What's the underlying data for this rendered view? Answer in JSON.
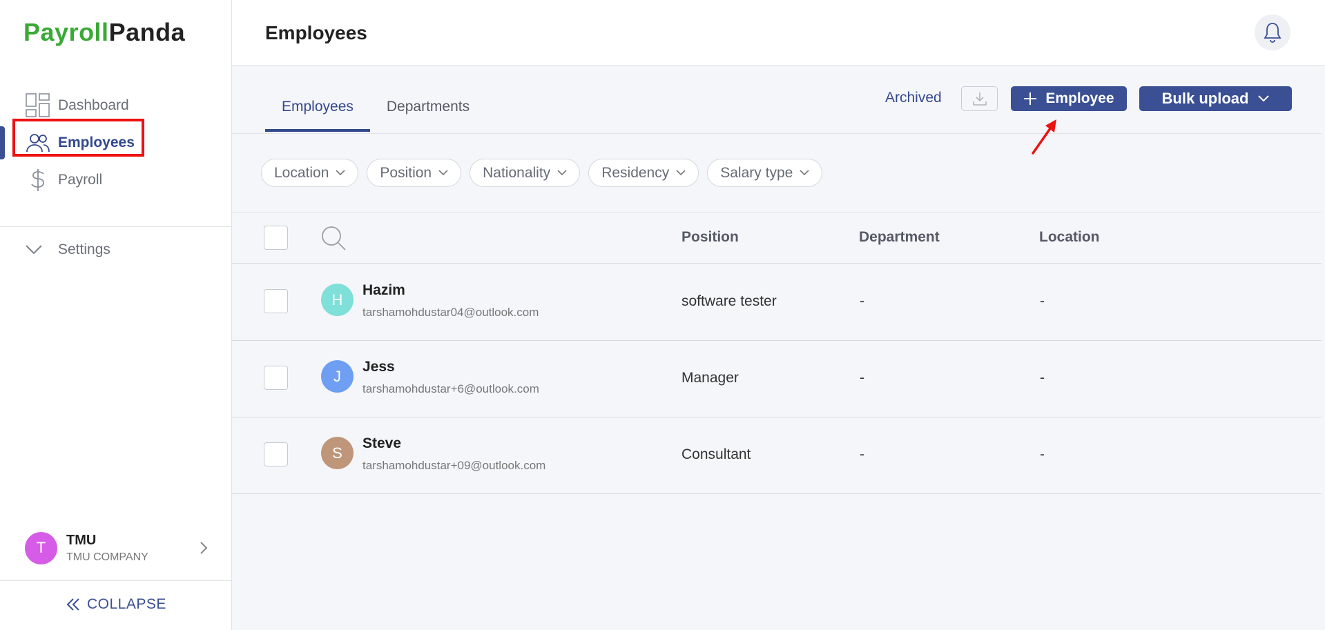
{
  "brand": {
    "part1": "Payroll",
    "part2": "Panda"
  },
  "sidebar": {
    "items": [
      {
        "label": "Dashboard",
        "icon": "dashboard-icon"
      },
      {
        "label": "Employees",
        "icon": "users-icon"
      },
      {
        "label": "Payroll",
        "icon": "dollar-icon"
      }
    ],
    "settings_label": "Settings",
    "company": {
      "initial": "T",
      "name": "TMU",
      "subtitle": "TMU COMPANY"
    },
    "collapse_label": "COLLAPSE"
  },
  "header": {
    "title": "Employees"
  },
  "tabs": [
    {
      "label": "Employees"
    },
    {
      "label": "Departments"
    }
  ],
  "actions": {
    "archived": "Archived",
    "add_employee": "Employee",
    "bulk_upload": "Bulk upload"
  },
  "filters": [
    {
      "label": "Location"
    },
    {
      "label": "Position"
    },
    {
      "label": "Nationality"
    },
    {
      "label": "Residency"
    },
    {
      "label": "Salary type"
    }
  ],
  "table": {
    "columns": [
      "Position",
      "Department",
      "Location"
    ],
    "rows": [
      {
        "initial": "H",
        "name": "Hazim",
        "email": "tarshamohdustar04@outlook.com",
        "position": "software tester",
        "department": "-",
        "location": "-",
        "avatar_color": "#7fdfd9"
      },
      {
        "initial": "J",
        "name": "Jess",
        "email": "tarshamohdustar+6@outlook.com",
        "position": "Manager",
        "department": "-",
        "location": "-",
        "avatar_color": "#6e9ff2"
      },
      {
        "initial": "S",
        "name": "Steve",
        "email": "tarshamohdustar+09@outlook.com",
        "position": "Consultant",
        "department": "-",
        "location": "-",
        "avatar_color": "#bf9679"
      }
    ]
  },
  "colors": {
    "brand_green": "#3aa935",
    "primary": "#3a4f94",
    "highlight": "#ee1111"
  }
}
